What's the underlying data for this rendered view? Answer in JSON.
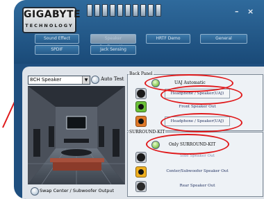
{
  "app": {
    "logo_brand": "GIGABYTE",
    "logo_sub": "TECHNOLOGY",
    "minimize_glyph": "–",
    "close_glyph": "×"
  },
  "tabs": [
    {
      "label": "Sound Effect",
      "active": false
    },
    {
      "label": "Speaker Configuration",
      "active": true
    },
    {
      "label": "HRTF Demo",
      "active": false
    },
    {
      "label": "General",
      "active": false
    },
    {
      "label": "SPDIF",
      "active": false
    },
    {
      "label": "Jack Sensing",
      "active": false
    }
  ],
  "speaker": {
    "selected": "8CH Speaker",
    "auto_test_label": "Auto Test",
    "swap_label": "Swap Center / Subwoofer Output"
  },
  "back_panel": {
    "title": "Back Panel",
    "uaj_label": "UAJ Automatic",
    "jacks": [
      {
        "label": "Headphone / Speaker(UAJ)",
        "color": "#1a1a1a",
        "dim": false
      },
      {
        "label": "Front Speaker Out",
        "color": "#6cc23a",
        "dim": false
      },
      {
        "label": "Headphone / Speaker(UAJ)",
        "color": "#e07a2a",
        "dim": false
      }
    ]
  },
  "surround_kit": {
    "title": "SURROUND-KIT",
    "only_label": "Only SURROUND-KIT",
    "jacks": [
      {
        "label": "Side Speaker Out",
        "color": "#1a1a1a",
        "dim": true
      },
      {
        "label": "Center/Subwoofer Speaker Out",
        "color": "#f0b020",
        "dim": false
      },
      {
        "label": "Rear Speaker Out",
        "color": "#2a2a2a",
        "dim": false
      }
    ]
  },
  "colors": {
    "window_blue": "#1f4f7f",
    "annotation_red": "#e0191b"
  }
}
